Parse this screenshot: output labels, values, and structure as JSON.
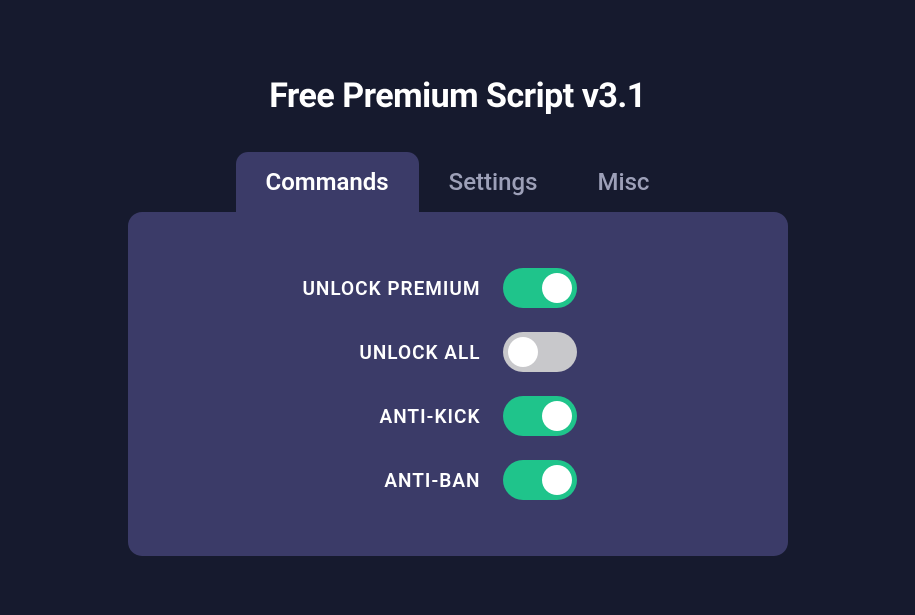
{
  "title": "Free Premium Script v3.1",
  "tabs": [
    {
      "label": "Commands",
      "active": true
    },
    {
      "label": "Settings",
      "active": false
    },
    {
      "label": "Misc",
      "active": false
    }
  ],
  "options": [
    {
      "label": "UNLOCK PREMIUM",
      "enabled": true
    },
    {
      "label": "UNLOCK ALL",
      "enabled": false
    },
    {
      "label": "ANTI-KICK",
      "enabled": true
    },
    {
      "label": "ANTI-BAN",
      "enabled": true
    }
  ],
  "colors": {
    "background": "#161a2e",
    "panel": "#3b3b68",
    "toggle_on": "#1fc48b",
    "toggle_off": "#c8c8cb"
  }
}
